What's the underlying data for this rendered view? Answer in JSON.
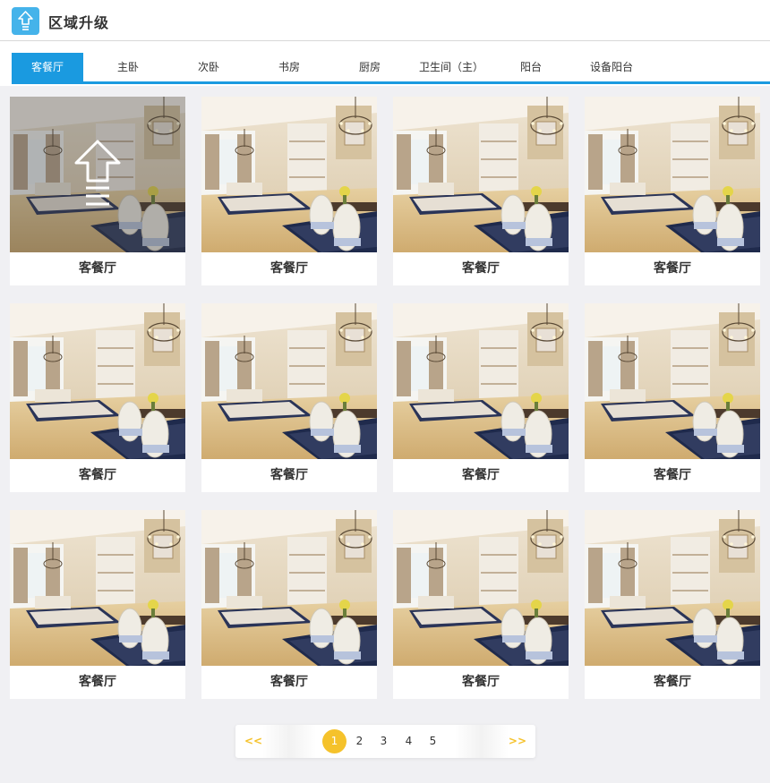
{
  "header": {
    "title": "区域升级",
    "icon": "upgrade-arrow-icon",
    "icon_color": "#45b3ea"
  },
  "tabs": [
    {
      "label": "客餐厅",
      "active": true
    },
    {
      "label": "主卧",
      "active": false
    },
    {
      "label": "次卧",
      "active": false
    },
    {
      "label": "书房",
      "active": false
    },
    {
      "label": "厨房",
      "active": false
    },
    {
      "label": "卫生间（主）",
      "active": false
    },
    {
      "label": "阳台",
      "active": false
    },
    {
      "label": "设备阳台",
      "active": false
    }
  ],
  "accent_color": "#1a9ae0",
  "cards": [
    {
      "label": "客餐厅",
      "hovered": true
    },
    {
      "label": "客餐厅"
    },
    {
      "label": "客餐厅"
    },
    {
      "label": "客餐厅"
    },
    {
      "label": "客餐厅"
    },
    {
      "label": "客餐厅"
    },
    {
      "label": "客餐厅"
    },
    {
      "label": "客餐厅"
    },
    {
      "label": "客餐厅"
    },
    {
      "label": "客餐厅"
    },
    {
      "label": "客餐厅"
    },
    {
      "label": "客餐厅"
    }
  ],
  "pagination": {
    "prev": "<<",
    "next": ">>",
    "pages": [
      "1",
      "2",
      "3",
      "4",
      "5"
    ],
    "current": "1",
    "highlight_color": "#f5c22b"
  }
}
